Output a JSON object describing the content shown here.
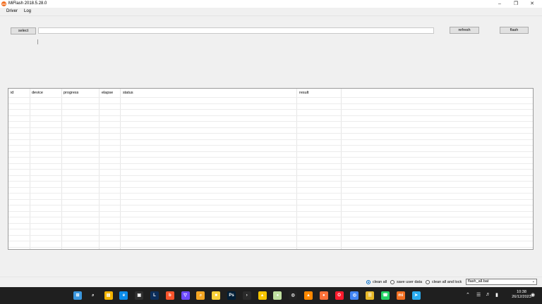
{
  "window": {
    "title": "MiFlash 2018.5.28.0",
    "app_icon": "mi-logo-icon"
  },
  "menu": {
    "items": [
      "Driver",
      "Log"
    ]
  },
  "toolbar": {
    "select_label": "select",
    "refresh_label": "refresh",
    "flash_label": "flash",
    "path_value": ""
  },
  "table": {
    "columns": [
      "id",
      "device",
      "progress",
      "elapse",
      "status",
      "result"
    ],
    "rows": []
  },
  "options": {
    "modes": [
      {
        "label": "clean all",
        "selected": true
      },
      {
        "label": "save user data",
        "selected": false
      },
      {
        "label": "clean all and lock",
        "selected": false
      }
    ],
    "script_value": "flash_all.bat"
  },
  "taskbar": {
    "icons": [
      "windows-start-icon",
      "search-icon",
      "file-explorer-icon",
      "edge-icon",
      "store-icon",
      "lightroom-icon",
      "brave-icon",
      "proton-vpn-icon",
      "magnifier-icon",
      "sticky-notes-icon",
      "photoshop-icon",
      "terminal-icon",
      "norton-icon",
      "sphere-icon",
      "steam-icon",
      "vlc-icon",
      "firefox-icon",
      "opera-icon",
      "chrome-icon",
      "layers-icon",
      "whatsapp-icon",
      "mi-icon",
      "telegram-icon"
    ],
    "time": "10:38",
    "date": "26/12/2023"
  },
  "colors": {
    "accent": "#0067c0",
    "mi_orange": "#f26f21",
    "taskbar": "#1f1f1f"
  }
}
